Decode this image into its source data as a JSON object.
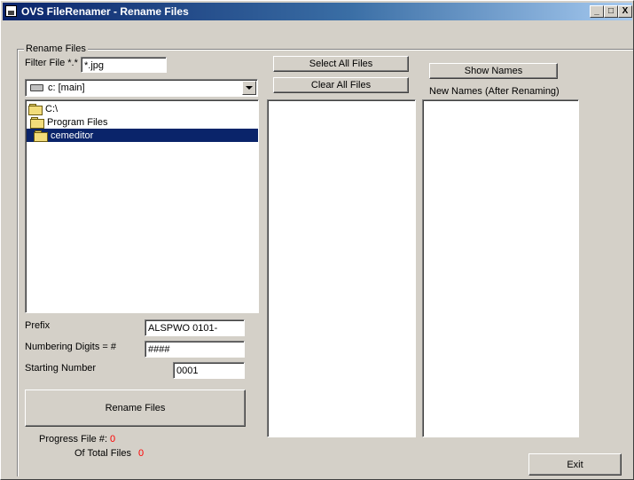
{
  "window": {
    "title": "OVS FileRenamer - Rename Files",
    "controls": [
      "_",
      "□",
      "X"
    ]
  },
  "group": {
    "legend": "Rename Files"
  },
  "filter": {
    "label": "Filter File *.*",
    "value": "*.jpg"
  },
  "drive": {
    "value": "c: [main]"
  },
  "tree": {
    "items": [
      {
        "label": "C:\\",
        "selected": false
      },
      {
        "label": "Program Files",
        "selected": false
      },
      {
        "label": "cemeditor",
        "selected": true
      }
    ]
  },
  "buttons": {
    "select_all": "Select All Files",
    "clear_all": "Clear All Files",
    "show_names": "Show Names",
    "rename": "Rename Files",
    "exit": "Exit"
  },
  "new_names": {
    "label": "New Names (After Renaming)"
  },
  "prefix": {
    "label": "Prefix",
    "value": "ALSPWO 0101-"
  },
  "digits": {
    "label": "Numbering Digits = #",
    "value": "####"
  },
  "start": {
    "label": "Starting Number",
    "value": "0001"
  },
  "progress": {
    "file_label": "Progress File #:",
    "file_value": "0",
    "total_label": "Of Total Files",
    "total_value": "0"
  }
}
